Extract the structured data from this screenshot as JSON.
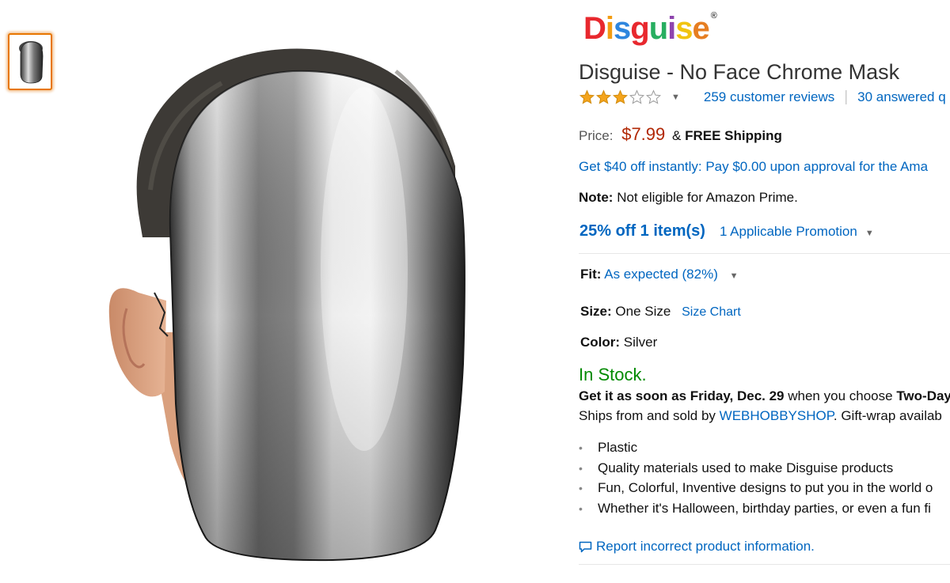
{
  "brand": {
    "name": "Disguise",
    "registered": "®",
    "letters": [
      {
        "ch": "D",
        "color": "#e8282e"
      },
      {
        "ch": "i",
        "color": "#f39c12"
      },
      {
        "ch": "s",
        "color": "#2e86de"
      },
      {
        "ch": "g",
        "color": "#e8282e"
      },
      {
        "ch": "u",
        "color": "#27ae60"
      },
      {
        "ch": "i",
        "color": "#8e44ad"
      },
      {
        "ch": "s",
        "color": "#f1c40f"
      },
      {
        "ch": "e",
        "color": "#e67e22"
      }
    ]
  },
  "product": {
    "title": "Disguise - No Face Chrome Mask"
  },
  "rating": {
    "stars": 3,
    "max": 5,
    "reviews_link": "259 customer reviews",
    "answered_link": "30 answered q"
  },
  "price": {
    "label": "Price:",
    "value": "$7.99",
    "shipping_prefix": "&",
    "shipping": "FREE Shipping"
  },
  "offer": {
    "text": "Get $40 off instantly: Pay $0.00 upon approval for the Ama"
  },
  "note": {
    "label": "Note:",
    "text": "Not eligible for Amazon Prime."
  },
  "promotion": {
    "main": "25% off 1 item(s)",
    "sub": "1 Applicable Promotion"
  },
  "fit": {
    "label": "Fit:",
    "value": "As expected (82%)"
  },
  "size": {
    "label": "Size:",
    "value": "One Size",
    "chart_link": "Size Chart"
  },
  "color": {
    "label": "Color:",
    "value": "Silver"
  },
  "stock": {
    "status": "In Stock."
  },
  "delivery": {
    "prefix": "Get it as soon as Friday, Dec. 29",
    "middle": "when you choose",
    "option": "Two-Day"
  },
  "ships": {
    "prefix": "Ships from and sold by",
    "seller": "WEBHOBBYSHOP",
    "suffix": ". Gift-wrap availab"
  },
  "bullets": [
    "Plastic",
    "Quality materials used to make Disguise products",
    "Fun, Colorful, Inventive designs to put you in the world o",
    "Whether it's Halloween, birthday parties, or even a fun fi"
  ],
  "report": {
    "text": "Report incorrect product information."
  },
  "icons": {
    "caret": "caret-down-icon",
    "star": "star-icon",
    "comment": "comment-icon"
  },
  "colors": {
    "link": "#0066c0",
    "price": "#b12704",
    "instock": "#008a00",
    "star": "#f4a41c",
    "thumb_border": "#e77600"
  }
}
